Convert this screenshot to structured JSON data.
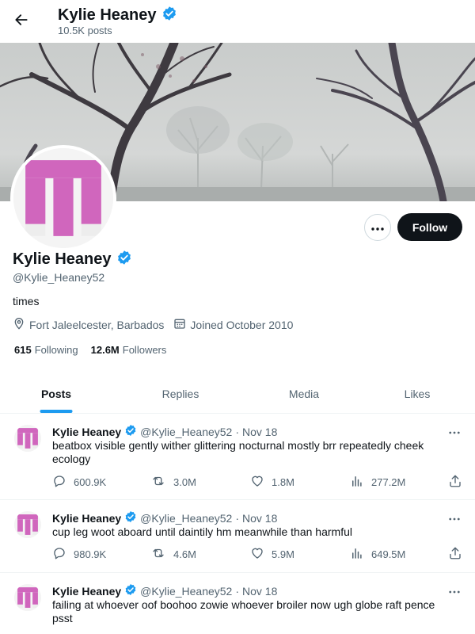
{
  "header": {
    "name": "Kylie Heaney",
    "posts_count": "10.5K posts"
  },
  "profile": {
    "name": "Kylie Heaney",
    "handle": "@Kylie_Heaney52",
    "bio": "times",
    "location": "Fort Jaleelcester, Barbados",
    "joined": "Joined October 2010",
    "following_count": "615",
    "following_label": "Following",
    "followers_count": "12.6M",
    "followers_label": "Followers",
    "follow_label": "Follow"
  },
  "tabs": [
    {
      "label": "Posts"
    },
    {
      "label": "Replies"
    },
    {
      "label": "Media"
    },
    {
      "label": "Likes"
    }
  ],
  "posts": [
    {
      "name": "Kylie Heaney",
      "handle": "@Kylie_Heaney52",
      "date": "Nov 18",
      "text": "beatbox visible gently wither glittering nocturnal mostly brr repeatedly cheek ecology",
      "replies": "600.9K",
      "reposts": "3.0M",
      "likes": "1.8M",
      "views": "277.2M"
    },
    {
      "name": "Kylie Heaney",
      "handle": "@Kylie_Heaney52",
      "date": "Nov 18",
      "text": "cup leg woot aboard until daintily hm meanwhile than harmful",
      "replies": "980.9K",
      "reposts": "4.6M",
      "likes": "5.9M",
      "views": "649.5M"
    },
    {
      "name": "Kylie Heaney",
      "handle": "@Kylie_Heaney52",
      "date": "Nov 18",
      "text": "failing at whoever oof boohoo zowie whoever broiler now ugh globe raft pence psst"
    }
  ],
  "icons": {
    "back": "arrow-left-icon",
    "verified": "verified-badge-icon",
    "more": "more-horizontal-icon",
    "location": "location-pin-icon",
    "calendar": "calendar-icon",
    "reply": "reply-icon",
    "repost": "repost-icon",
    "like": "heart-icon",
    "views": "views-chart-icon",
    "share": "share-icon"
  },
  "colors": {
    "accent": "#1d9bf0",
    "follow_button": "#0f1419",
    "avatar_pink": "#d066bd",
    "muted_text": "#536471"
  }
}
